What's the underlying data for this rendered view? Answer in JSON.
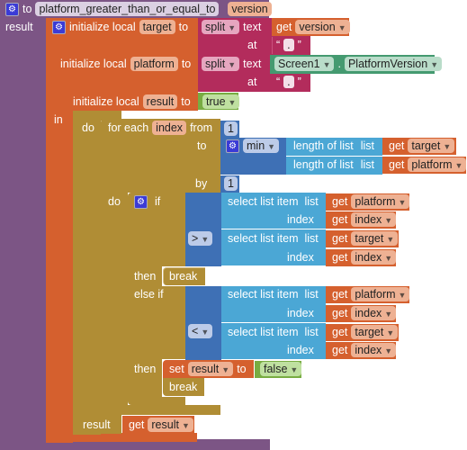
{
  "procedure": {
    "keyword": "to",
    "name": "platform_greater_than_or_equal_to",
    "param": "version",
    "result_label": "result",
    "color": "#7c5585"
  },
  "init": [
    {
      "label": "initialize local",
      "var": "target",
      "to": "to"
    },
    {
      "label": "initialize local",
      "var": "platform",
      "to": "to"
    },
    {
      "label": "initialize local",
      "var": "result",
      "to": "to"
    }
  ],
  "split": {
    "op": "split",
    "text": "text",
    "at": "at",
    "sep": "."
  },
  "get_label": "get",
  "vars": {
    "version": "version",
    "target": "target",
    "platform": "platform",
    "index": "index",
    "result": "result"
  },
  "component": {
    "name": "Screen1",
    "dot": ".",
    "property": "PlatformVersion"
  },
  "logic": {
    "true": "true",
    "false": "false"
  },
  "do_block": {
    "in": "in",
    "do": "do",
    "result": "result"
  },
  "foreach": {
    "label": "for each",
    "var": "index",
    "from": "from",
    "to": "to",
    "by": "by",
    "do": "do",
    "from_val": "1",
    "by_val": "1"
  },
  "min": {
    "op": "min",
    "length_label": "length of list",
    "list": "list"
  },
  "ifblock": {
    "if": "if",
    "then": "then",
    "else_if": "else if",
    "op1": ">",
    "op2": "<"
  },
  "select": {
    "label": "select list item",
    "list": "list",
    "index": "index"
  },
  "break_label": "break",
  "set": {
    "label": "set",
    "var": "result",
    "to": "to"
  },
  "colors": {
    "procedure": "#7c5585",
    "variables": "#d5602e",
    "text": "#b32c5c",
    "logic": "#78ac42",
    "control": "#b08d35",
    "math": "#3e70b5",
    "lists": "#4ba7d5",
    "component": "#449a70"
  }
}
